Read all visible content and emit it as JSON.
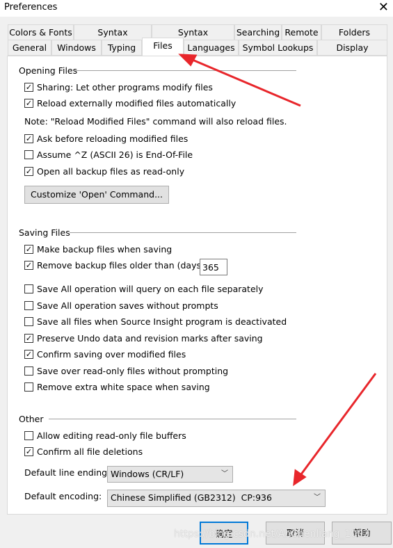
{
  "window": {
    "title": "Preferences",
    "close_icon": "close-icon"
  },
  "tabs_row1": [
    "Colors & Fonts",
    "Syntax Formatting",
    "Syntax Decorations",
    "Searching",
    "Remote",
    "Folders"
  ],
  "tabs_row2": [
    "General",
    "Windows",
    "Typing",
    "Files",
    "Languages",
    "Symbol Lookups",
    "Display"
  ],
  "selected_tab": "Files",
  "opening": {
    "heading": "Opening Files",
    "items": [
      {
        "label": "Sharing: Let other programs modify files",
        "checked": true
      },
      {
        "label": "Reload externally modified files automatically",
        "checked": true
      }
    ],
    "note": "Note: \"Reload Modified Files\" command will also reload files.",
    "items2": [
      {
        "label": "Ask before reloading modified files",
        "checked": true
      },
      {
        "label": "Assume ^Z (ASCII 26) is End-Of-File",
        "checked": false
      },
      {
        "label": "Open all backup files as read-only",
        "checked": true
      }
    ],
    "customize_button": "Customize 'Open' Command..."
  },
  "saving": {
    "heading": "Saving Files",
    "make_backup": {
      "label": "Make backup files when saving",
      "checked": true
    },
    "remove_backup": {
      "label": "Remove backup files older than (days):",
      "checked": true,
      "value": "365"
    },
    "items": [
      {
        "label": "Save All operation will query on each file separately",
        "checked": false
      },
      {
        "label": "Save All operation saves without prompts",
        "checked": false
      },
      {
        "label": "Save all files when Source Insight program is deactivated",
        "checked": false
      },
      {
        "label": "Preserve Undo data and revision marks after saving",
        "checked": true
      },
      {
        "label": "Confirm saving over modified files",
        "checked": true
      },
      {
        "label": "Save over read-only files without prompting",
        "checked": false
      },
      {
        "label": "Remove extra white space when saving",
        "checked": false
      }
    ]
  },
  "other": {
    "heading": "Other",
    "items": [
      {
        "label": "Allow editing read-only file buffers",
        "checked": false
      },
      {
        "label": "Confirm all file deletions",
        "checked": true
      }
    ],
    "line_ending_label": "Default line ending:",
    "line_ending_value": "Windows (CR/LF)",
    "encoding_label": "Default encoding:",
    "encoding_value": "Chinese Simplified (GB2312)  CP:936"
  },
  "buttons": {
    "ok": "确定",
    "cancel": "取消",
    "help": "帮助"
  },
  "watermark": "https://blog.csdn.net/AnChenliang_1002",
  "colors": {
    "annotation_arrow": "#e8262b",
    "default_button_border": "#0078d7"
  }
}
